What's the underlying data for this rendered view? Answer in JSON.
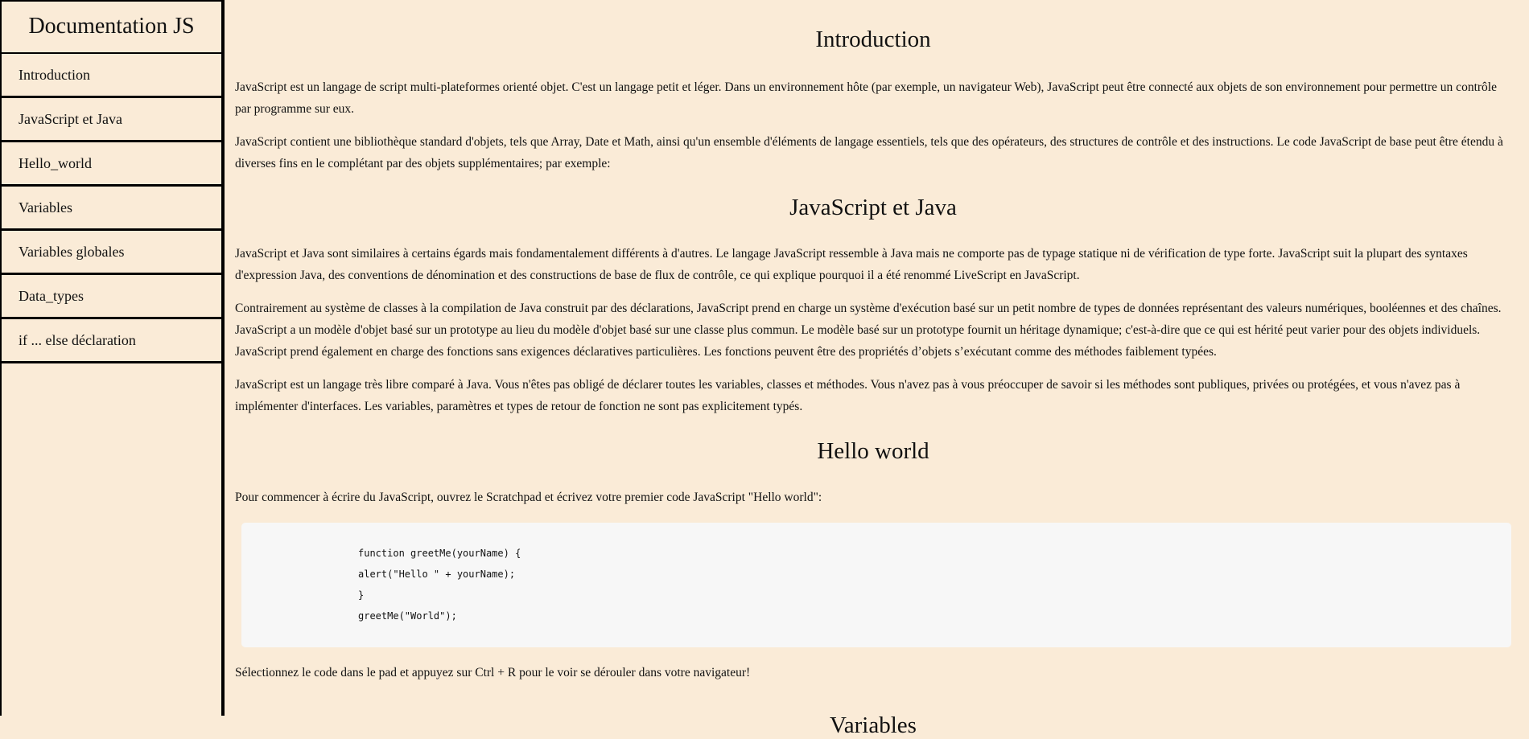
{
  "nav": {
    "title": "Documentation JS",
    "links": [
      "Introduction",
      "JavaScript et Java",
      "Hello_world",
      "Variables",
      "Variables globales",
      "Data_types",
      "if ... else déclaration"
    ]
  },
  "sections": {
    "introduction": {
      "title": "Introduction",
      "paragraphs": [
        "JavaScript est un langage de script multi-plateformes orienté objet. C'est un langage petit et léger. Dans un environnement hôte (par exemple, un navigateur Web), JavaScript peut être connecté aux objets de son environnement pour permettre un contrôle par programme sur eux.",
        "JavaScript contient une bibliothèque standard d'objets, tels que Array, Date et Math, ainsi qu'un ensemble d'éléments de langage essentiels, tels que des opérateurs, des structures de contrôle et des instructions. Le code JavaScript de base peut être étendu à diverses fins en le complétant par des objets supplémentaires; par exemple:"
      ]
    },
    "javascript_java": {
      "title": "JavaScript et Java",
      "paragraphs": [
        "JavaScript et Java sont similaires à certains égards mais fondamentalement différents à d'autres. Le langage JavaScript ressemble à Java mais ne comporte pas de typage statique ni de vérification de type forte. JavaScript suit la plupart des syntaxes d'expression Java, des conventions de dénomination et des constructions de base de flux de contrôle, ce qui explique pourquoi il a été renommé LiveScript en JavaScript.",
        "Contrairement au système de classes à la compilation de Java construit par des déclarations, JavaScript prend en charge un système d'exécution basé sur un petit nombre de types de données représentant des valeurs numériques, booléennes et des chaînes. JavaScript a un modèle d'objet basé sur un prototype au lieu du modèle d'objet basé sur une classe plus commun. Le modèle basé sur un prototype fournit un héritage dynamique; c'est-à-dire que ce qui est hérité peut varier pour des objets individuels. JavaScript prend également en charge des fonctions sans exigences déclaratives particulières. Les fonctions peuvent être des propriétés d’objets s’exécutant comme des méthodes faiblement typées.",
        "JavaScript est un langage très libre comparé à Java. Vous n'êtes pas obligé de déclarer toutes les variables, classes et méthodes. Vous n'avez pas à vous préoccuper de savoir si les méthodes sont publiques, privées ou protégées, et vous n'avez pas à implémenter d'interfaces. Les variables, paramètres et types de retour de fonction ne sont pas explicitement typés."
      ]
    },
    "hello_world": {
      "title": "Hello world",
      "intro": "Pour commencer à écrire du JavaScript, ouvrez le Scratchpad et écrivez votre premier code JavaScript \"Hello world\":",
      "code": [
        "function greetMe(yourName) {",
        "alert(\"Hello \" + yourName);",
        "}",
        "greetMe(\"World\");"
      ],
      "outro": "Sélectionnez le code dans le pad et appuyez sur Ctrl + R pour le voir se dérouler dans votre navigateur!"
    },
    "variables": {
      "title": "Variables"
    }
  }
}
